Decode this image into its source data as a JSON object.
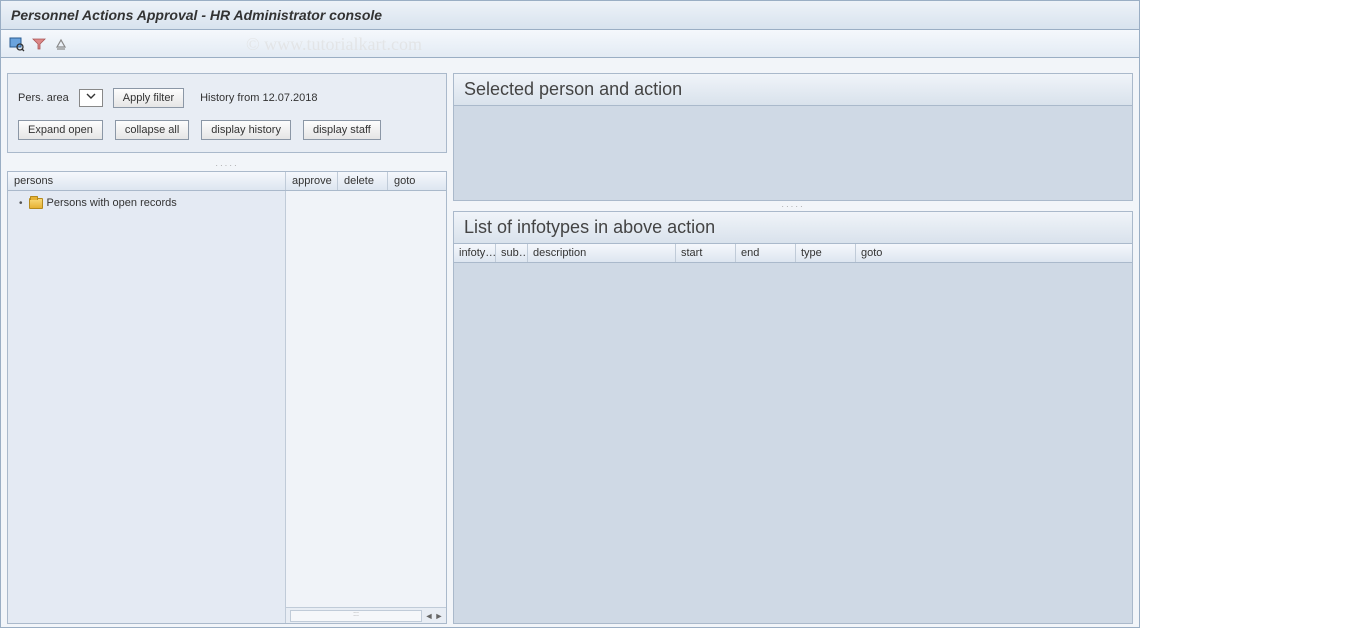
{
  "window": {
    "title": "Personnel Actions Approval - HR Administrator console"
  },
  "watermark": "© www.tutorialkart.com",
  "filter": {
    "pers_area_label": "Pers. area",
    "apply_filter_label": "Apply filter",
    "history_label": "History from 12.07.2018",
    "buttons": {
      "expand_open": "Expand open",
      "collapse_all": "collapse all",
      "display_history": "display history",
      "display_staff": "display staff"
    }
  },
  "tree": {
    "headers": {
      "persons": "persons",
      "approve": "approve",
      "delete": "delete",
      "goto": "goto"
    },
    "items": [
      {
        "label": "Persons with open records"
      }
    ]
  },
  "right": {
    "selected_title": "Selected person and action",
    "list_title": "List of infotypes in above action",
    "infotype_headers": {
      "infoty": "infoty…",
      "sub": "sub…",
      "description": "description",
      "start": "start",
      "end": "end",
      "type": "type",
      "goto": "goto"
    }
  }
}
